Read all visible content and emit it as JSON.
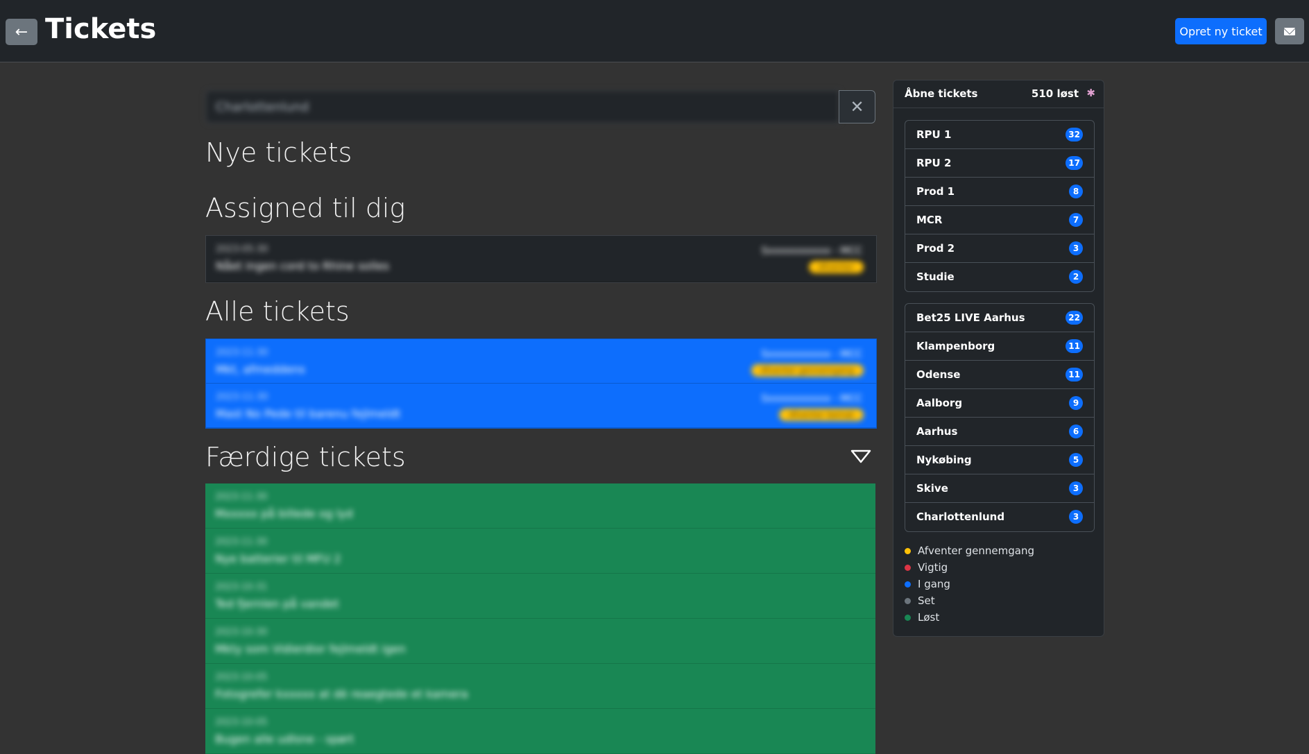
{
  "header": {
    "back_icon": "arrow-left-icon",
    "title": "Tickets",
    "new_ticket_label": "Opret ny ticket",
    "mail_icon": "envelope-icon"
  },
  "search": {
    "value": "Charlottenlund",
    "clear_icon": "close-icon"
  },
  "sections": {
    "new": "Nye tickets",
    "assigned": "Assigned til dig",
    "all": "Alle tickets",
    "done": "Færdige tickets"
  },
  "assigned_tickets": [
    {
      "date": "2023-05-30",
      "title": "Nået ingen cord to Rhine solles",
      "user": "Sxxxxxxxxxxx - MCC",
      "tag": "Afventer"
    }
  ],
  "all_tickets": [
    {
      "date": "2023-11-30",
      "title": "Mkt, afmeddens",
      "user": "Sxxxxxxxxxxx - MCC",
      "tag": "Afventer gennemgang"
    },
    {
      "date": "2023-11-30",
      "title": "Mast No Pede til barenu fejlmeldt",
      "user": "Sxxxxxxxxxxx - MCC",
      "tag": "Afventer bemat"
    }
  ],
  "done_tickets": [
    {
      "date": "2023-11-30",
      "title": "Mxxxxx på billede og lyd"
    },
    {
      "date": "2023-11-30",
      "title": "Nye batterier til MFU 2"
    },
    {
      "date": "2023-10-31",
      "title": "Ted fjernlen på vandet"
    },
    {
      "date": "2023-10-30",
      "title": "Mkty som Vidierdior fejlmeldt igen"
    },
    {
      "date": "2023-10-05",
      "title": "Fotogrefer kxxxxx at dè reaegtede et kamera"
    },
    {
      "date": "2023-10-05",
      "title": "Bugen alle udlsne - spørt"
    }
  ],
  "sidebar": {
    "title": "Åbne tickets",
    "solved": "510 løst",
    "party_icon": "party-popper-icon",
    "groups": [
      [
        {
          "label": "RPU 1",
          "count": "32"
        },
        {
          "label": "RPU 2",
          "count": "17"
        },
        {
          "label": "Prod 1",
          "count": "8"
        },
        {
          "label": "MCR",
          "count": "7"
        },
        {
          "label": "Prod 2",
          "count": "3"
        },
        {
          "label": "Studie",
          "count": "2"
        }
      ],
      [
        {
          "label": "Bet25 LIVE Aarhus",
          "count": "22"
        },
        {
          "label": "Klampenborg",
          "count": "11"
        },
        {
          "label": "Odense",
          "count": "11"
        },
        {
          "label": "Aalborg",
          "count": "9"
        },
        {
          "label": "Aarhus",
          "count": "6"
        },
        {
          "label": "Nykøbing",
          "count": "5"
        },
        {
          "label": "Skive",
          "count": "3"
        },
        {
          "label": "Charlottenlund",
          "count": "3"
        }
      ]
    ],
    "legend": [
      {
        "label": "Afventer gennemgang",
        "color": "#ffc107"
      },
      {
        "label": "Vigtig",
        "color": "#dc3545"
      },
      {
        "label": "I gang",
        "color": "#0d6efd"
      },
      {
        "label": "Set",
        "color": "#6c757d"
      },
      {
        "label": "Løst",
        "color": "#198754"
      }
    ]
  },
  "colors": {
    "accent": "#0d6efd",
    "done": "#198754",
    "pending": "#ffc107"
  }
}
